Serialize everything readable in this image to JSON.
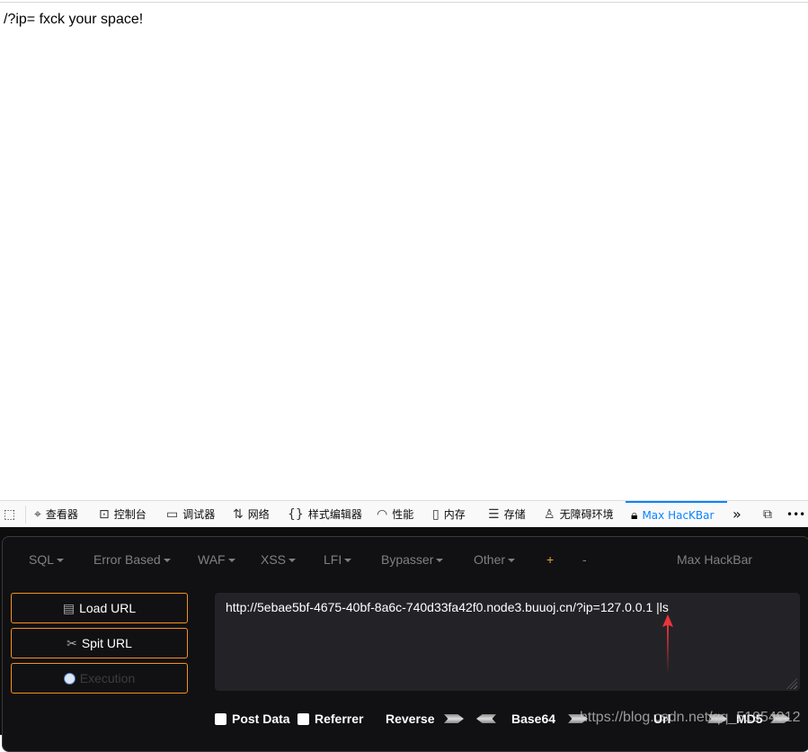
{
  "page": {
    "text": "/?ip= fxck your space!"
  },
  "devtools": {
    "tabs": [
      {
        "label": "查看器",
        "icon": "inspector-icon"
      },
      {
        "label": "控制台",
        "icon": "console-icon"
      },
      {
        "label": "调试器",
        "icon": "debugger-icon"
      },
      {
        "label": "网络",
        "icon": "network-icon"
      },
      {
        "label": "样式编辑器",
        "icon": "style-editor-icon"
      },
      {
        "label": "性能",
        "icon": "performance-icon"
      },
      {
        "label": "内存",
        "icon": "memory-icon"
      },
      {
        "label": "存储",
        "icon": "storage-icon"
      },
      {
        "label": "无障碍环境",
        "icon": "accessibility-icon"
      },
      {
        "label": "Max HacKBar",
        "icon": "hackbar-icon",
        "active": true
      }
    ],
    "accent": "#0a84ff"
  },
  "hackbar": {
    "menu": [
      "SQL",
      "Error Based",
      "WAF",
      "XSS",
      "LFI",
      "Bypasser",
      "Other",
      "+",
      "-"
    ],
    "brand": "Max HackBar",
    "buttons": {
      "load": "Load URL",
      "split": "Spit URL",
      "execute": "Execution"
    },
    "url": "http://5ebae5bf-4675-40bf-8a6c-740d33fa42f0.node3.buuoj.cn/?ip=127.0.0.1 |ls",
    "options": {
      "post_data": "Post Data",
      "referrer": "Referrer",
      "reverse": "Reverse",
      "base64": "Base64",
      "url": "Url",
      "md5": "MD5"
    },
    "border_color": "#f5931c"
  },
  "watermark": "https://blog.csdn.net/qq_51954912"
}
